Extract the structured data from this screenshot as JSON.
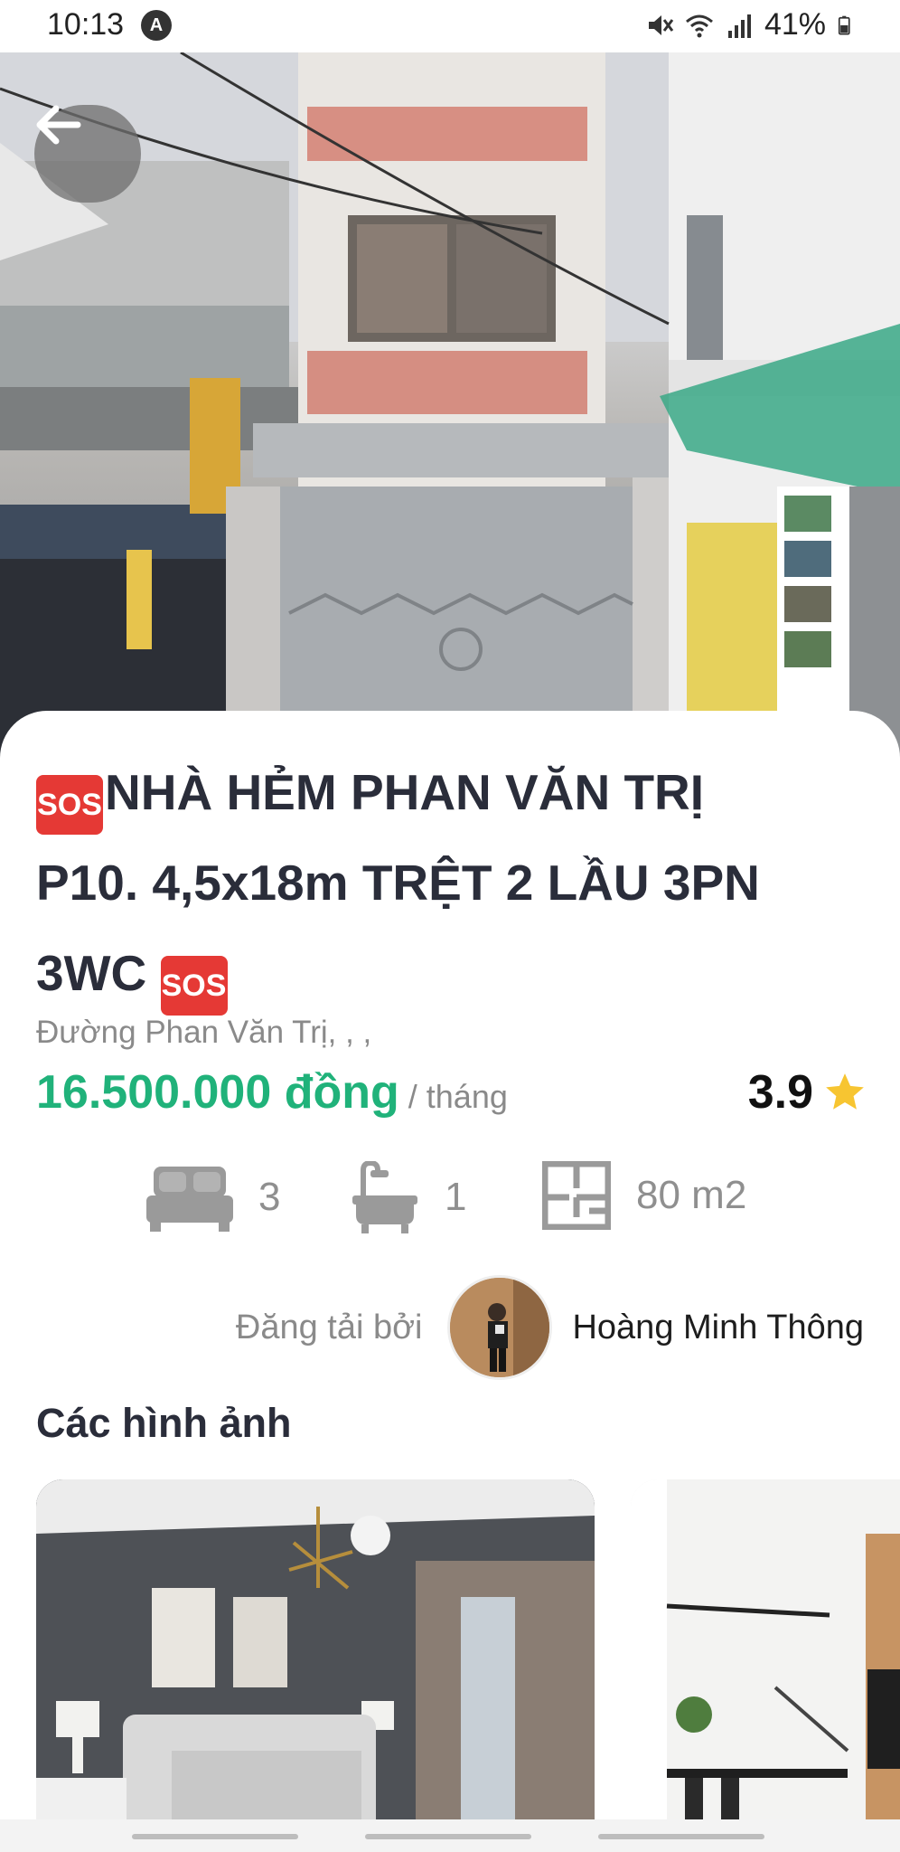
{
  "status_bar": {
    "time": "10:13",
    "battery": "41%",
    "icons": [
      "mute-icon",
      "wifi-icon",
      "signal-icon",
      "battery-icon"
    ]
  },
  "hero": {
    "back_icon": "arrow-left-icon"
  },
  "listing": {
    "title_line1": "NHÀ HẺM PHAN VĂN TRỊ",
    "title_line2": "P10. 4,5x18m TRỆT 2 LẦU 3PN",
    "title_line3": "3WC",
    "sos_badge": "SOS",
    "address": "Đường Phan Văn Trị, , ,",
    "price": "16.500.000 đồng",
    "price_unit": "/ tháng",
    "rating": "3.9",
    "specs": {
      "bedrooms": "3",
      "bathrooms": "1",
      "area": "80 m2"
    }
  },
  "owner": {
    "label": "Đăng tải bởi",
    "name": "Hoàng Minh Thông"
  },
  "gallery": {
    "title": "Các hình ảnh"
  },
  "colors": {
    "price": "#20b27a",
    "title": "#2a2d3a",
    "sos": "#e53935",
    "star": "#f7c531"
  }
}
